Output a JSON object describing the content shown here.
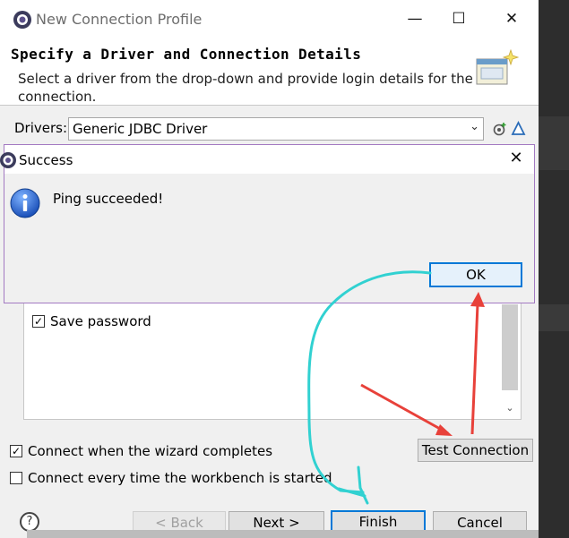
{
  "window": {
    "title": "New Connection Profile",
    "minimize": "—",
    "maximize": "☐",
    "close": "✕"
  },
  "header": {
    "title": "Specify a Driver and Connection Details",
    "description": "Select a driver from the drop-down and provide login details for the connection."
  },
  "drivers": {
    "label": "Drivers:",
    "value": "Generic JDBC Driver",
    "arrow": "⌄"
  },
  "properties": {
    "save_password_label": "Save password",
    "save_password_checked": "✓",
    "scroll_down": "⌄"
  },
  "options": {
    "connect_when_completes_label": "Connect when the wizard completes",
    "connect_when_completes_checked": "✓",
    "connect_every_time_label": "Connect every time the workbench is started",
    "test_connection_label": "Test Connection"
  },
  "nav": {
    "help": "?",
    "back_label": "< Back",
    "next_label": "Next >",
    "finish_label": "Finish",
    "cancel_label": "Cancel"
  },
  "dialog": {
    "title": "Success",
    "close": "✕",
    "message": "Ping succeeded!",
    "ok_label": "OK"
  },
  "colors": {
    "focus_blue": "#0078d7",
    "annotation_red": "#e8413a",
    "annotation_cyan": "#31d1d1",
    "dialog_border": "#a37ac2"
  }
}
